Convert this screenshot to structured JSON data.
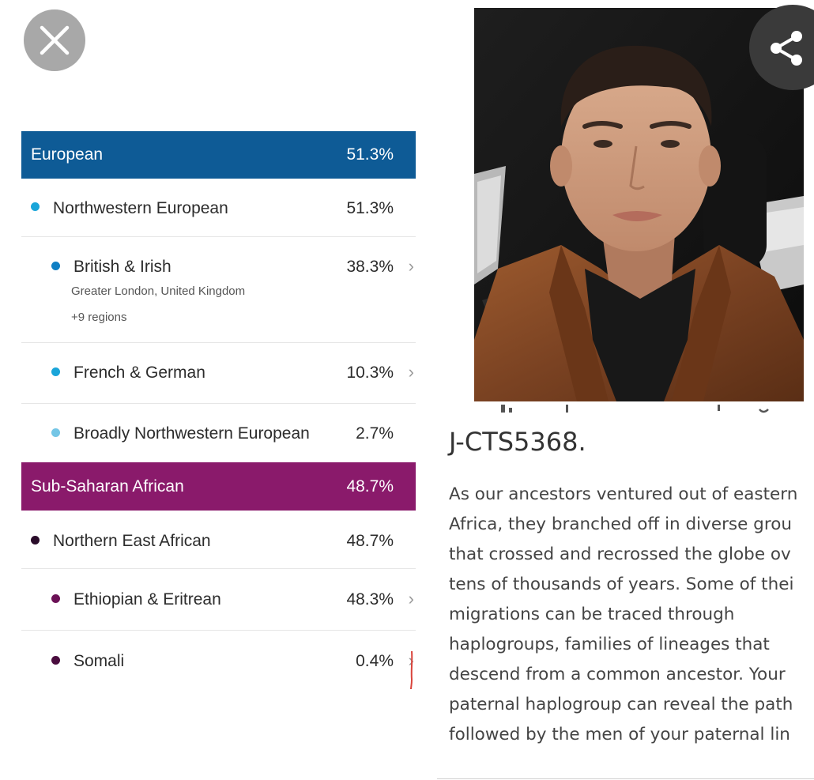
{
  "buttons": {
    "close_icon": "close-icon",
    "share_icon": "share-icon"
  },
  "colors": {
    "european": "#0e5b96",
    "african": "#8a1a6b",
    "nw_european_dot": "#1aa5d9",
    "african_dot": "#6b1156"
  },
  "ancestry": {
    "european": {
      "label": "European",
      "percent": "51.3%",
      "groups": [
        {
          "label": "Northwestern European",
          "percent": "51.3%",
          "children": [
            {
              "label": "British & Irish",
              "percent": "38.3%",
              "location": "Greater London, United Kingdom",
              "more": "+9 regions"
            },
            {
              "label": "French & German",
              "percent": "10.3%"
            },
            {
              "label": "Broadly Northwestern European",
              "percent": "2.7%"
            }
          ]
        }
      ]
    },
    "african": {
      "label": "Sub-Saharan African",
      "percent": "48.7%",
      "groups": [
        {
          "label": "Northern East African",
          "percent": "48.7%",
          "children": [
            {
              "label": "Ethiopian & Eritrean",
              "percent": "48.3%"
            },
            {
              "label": "Somali",
              "percent": "0.4%"
            }
          ]
        }
      ]
    }
  },
  "haplogroup": {
    "title": "J-CTS5368.",
    "paragraph_lines": [
      "As our ancestors ventured out of eastern",
      "Africa, they branched off in diverse grou",
      "that crossed and recrossed the globe ov",
      "tens of thousands of years. Some of thei",
      "migrations can be traced through",
      "haplogroups, families of lineages that",
      "descend from a common ancestor. Your",
      "paternal haplogroup can reveal the path",
      "followed by the men of your paternal lin"
    ]
  }
}
